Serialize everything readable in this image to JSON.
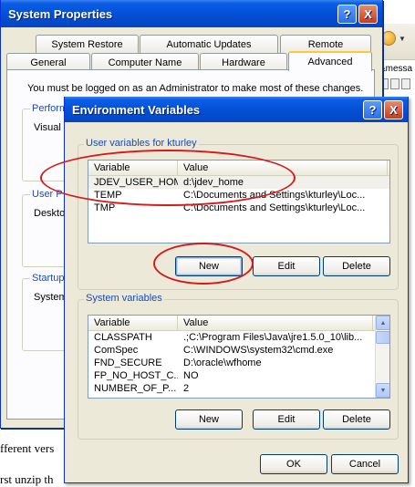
{
  "background": {
    "url_fragment": "&messa",
    "text_line_1": "fferent vers",
    "text_line_2": "rst unzip th"
  },
  "system_properties": {
    "title": "System Properties",
    "help_label": "?",
    "close_label": "X",
    "tabs_row1": [
      "System Restore",
      "Automatic Updates",
      "Remote"
    ],
    "tabs_row2": [
      "General",
      "Computer Name",
      "Hardware",
      "Advanced"
    ],
    "active_tab": "Advanced",
    "admin_note": "You must be logged on as an Administrator to make most of these changes.",
    "groups": [
      {
        "label": "Perform",
        "text": "Visual e"
      },
      {
        "label": "User P",
        "text": "Deskto"
      },
      {
        "label": "Startup",
        "text": "System"
      }
    ]
  },
  "environment_variables": {
    "title": "Environment Variables",
    "help_label": "?",
    "close_label": "X",
    "user_group_label": "User variables for kturley",
    "system_group_label": "System variables",
    "columns": {
      "variable": "Variable",
      "value": "Value"
    },
    "user_vars": [
      {
        "variable": "JDEV_USER_HOME",
        "value": "d:\\jdev_home"
      },
      {
        "variable": "TEMP",
        "value": "C:\\Documents and Settings\\kturley\\Loc..."
      },
      {
        "variable": "TMP",
        "value": "C:\\Documents and Settings\\kturley\\Loc..."
      }
    ],
    "system_vars": [
      {
        "variable": "CLASSPATH",
        "value": ".;C:\\Program Files\\Java\\jre1.5.0_10\\lib..."
      },
      {
        "variable": "ComSpec",
        "value": "C:\\WINDOWS\\system32\\cmd.exe"
      },
      {
        "variable": "FND_SECURE",
        "value": "D:\\oracle\\wfhome"
      },
      {
        "variable": "FP_NO_HOST_C...",
        "value": "NO"
      },
      {
        "variable": "NUMBER_OF_P...",
        "value": "2"
      }
    ],
    "buttons": {
      "new": "New",
      "edit": "Edit",
      "delete": "Delete",
      "ok": "OK",
      "cancel": "Cancel"
    }
  },
  "colors": {
    "annotation": "#d61a1a",
    "xp_title_blue": "#0450d6",
    "group_label_blue": "#1b4bb5"
  }
}
